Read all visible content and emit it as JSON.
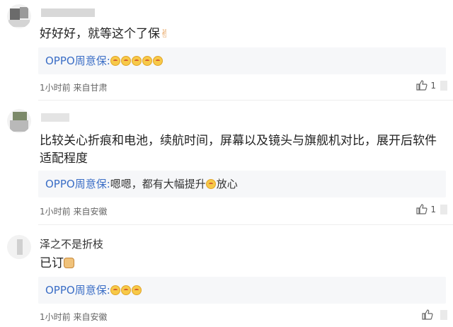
{
  "comments": [
    {
      "username": "",
      "text": "好好好，就等这个了保",
      "reply_author": "OPPO周意保:",
      "reply_text": "",
      "time": "1小时前",
      "location": "来自甘肃",
      "likes": "1"
    },
    {
      "username": "",
      "text": "比较关心折痕和电池，续航时间，屏幕以及镜头与旗舰机对比，展开后软件适配程度",
      "reply_author": "OPPO周意保:",
      "reply_text": "嗯嗯，都有大幅提升",
      "reply_text_after": "放心",
      "time": "1小时前",
      "location": "来自安徽",
      "likes": "1"
    },
    {
      "username": "泽之不是折枝",
      "text": "已订",
      "reply_author": "OPPO周意保:",
      "reply_text": "",
      "time": "1小时前",
      "location": "来自安徽",
      "likes": ""
    }
  ],
  "icons": {
    "like": "thumbs-up-icon",
    "emoji": "smile-emoji-icon",
    "victory": "victory-hand-icon",
    "dog": "dog-emoji-icon"
  },
  "colors": {
    "reply_author": "#3b6ec6",
    "reply_bg": "#f6f7f9"
  }
}
